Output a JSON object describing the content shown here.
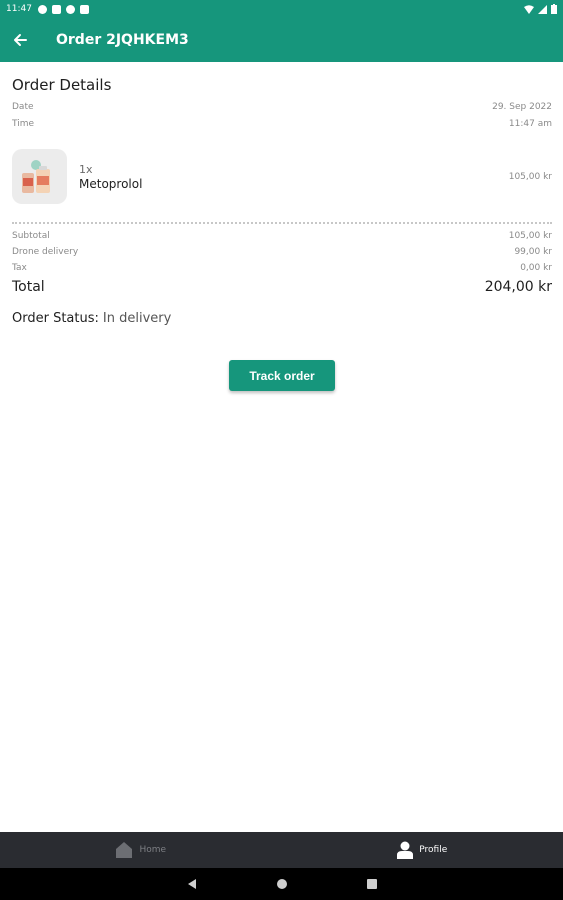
{
  "status_bar": {
    "time": "11:47"
  },
  "app_bar": {
    "title": "Order 2JQHKEM3"
  },
  "order": {
    "section_title": "Order Details",
    "date_label": "Date",
    "date_value": "29. Sep 2022",
    "time_label": "Time",
    "time_value": "11:47 am",
    "item": {
      "qty": "1x",
      "name": "Metoprolol",
      "price": "105,00 kr"
    },
    "subtotal_label": "Subtotal",
    "subtotal_value": "105,00 kr",
    "delivery_label": "Drone delivery",
    "delivery_value": "99,00 kr",
    "tax_label": "Tax",
    "tax_value": "0,00 kr",
    "total_label": "Total",
    "total_value": "204,00 kr",
    "status_label": "Order Status:",
    "status_value": "In delivery"
  },
  "actions": {
    "track_label": "Track order"
  },
  "bottom_nav": {
    "items": [
      {
        "label": "Home",
        "icon": "home-icon",
        "active": false
      },
      {
        "label": "Profile",
        "icon": "profile-icon",
        "active": true
      }
    ]
  },
  "colors": {
    "primary": "#16967c",
    "nav_bg": "#2a2c31"
  }
}
